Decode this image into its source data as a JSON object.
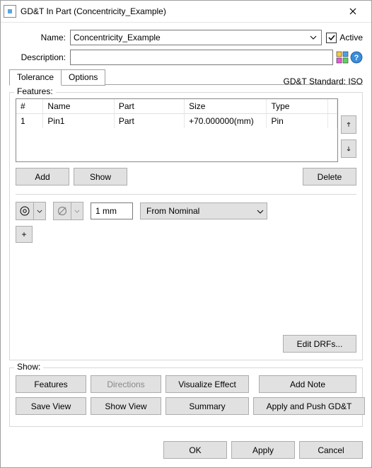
{
  "window": {
    "title": "GD&T In Part (Concentricity_Example)"
  },
  "form": {
    "name_label": "Name:",
    "name_value": "Concentricity_Example",
    "active_label": "Active",
    "active_checked": true,
    "description_label": "Description:",
    "description_value": ""
  },
  "icons": {
    "tool1": "grid-colors-icon",
    "tool2": "help-icon"
  },
  "tabs": {
    "items": [
      {
        "label": "Tolerance",
        "active": true
      },
      {
        "label": "Options",
        "active": false
      }
    ],
    "standard_label": "GD&T Standard: ISO"
  },
  "features": {
    "legend": "Features:",
    "columns": {
      "num": "#",
      "name": "Name",
      "part": "Part",
      "size": "Size",
      "type": "Type"
    },
    "rows": [
      {
        "num": "1",
        "name": "Pin1",
        "part": "Part",
        "size": "+70.000000(mm)",
        "type": "Pin"
      }
    ],
    "buttons": {
      "add": "Add",
      "show": "Show",
      "delete": "Delete"
    }
  },
  "tolerance": {
    "symbol": "concentricity-icon",
    "modifier": "diameter-icon",
    "value": "1 mm",
    "origin": "From Nominal",
    "plus": "+",
    "edit_drfs": "Edit DRFs..."
  },
  "show": {
    "legend": "Show:",
    "buttons": {
      "features": "Features",
      "directions": "Directions",
      "visualize": "Visualize Effect",
      "add_note": "Add Note",
      "save_view": "Save View",
      "show_view": "Show View",
      "summary": "Summary",
      "apply_push": "Apply and Push GD&T"
    }
  },
  "footer": {
    "ok": "OK",
    "apply": "Apply",
    "cancel": "Cancel"
  }
}
